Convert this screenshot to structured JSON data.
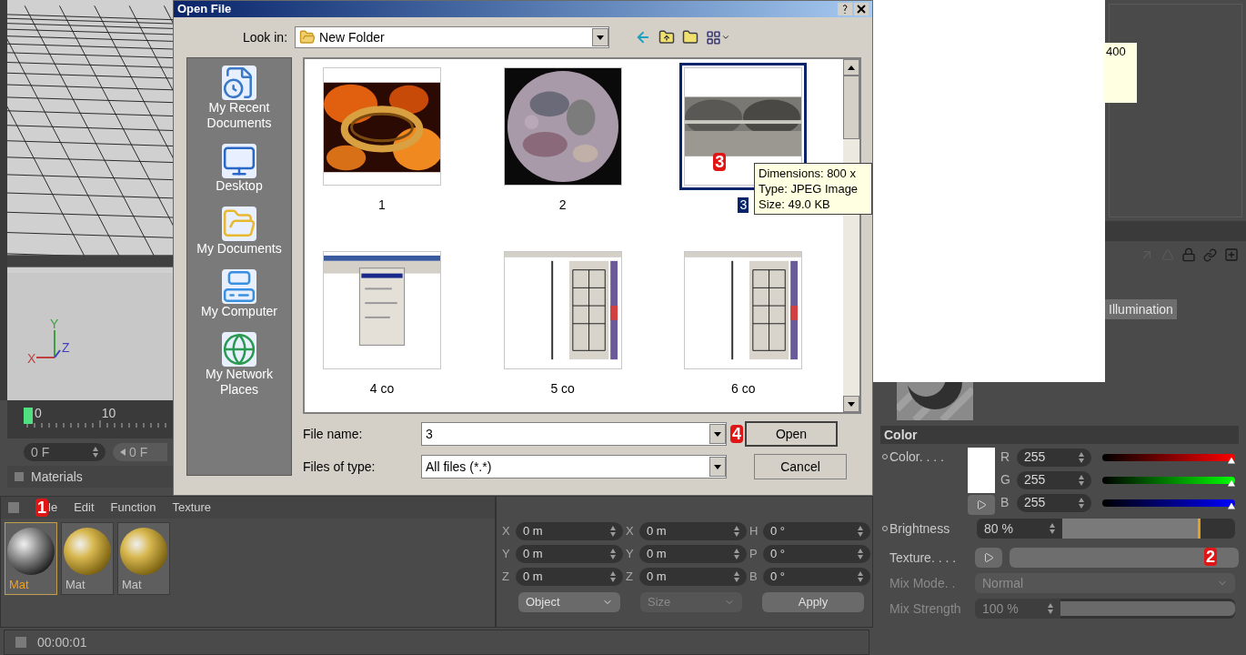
{
  "viewport": {
    "axes": [
      "X",
      "Y",
      "Z"
    ]
  },
  "timeline": {
    "ticks": [
      "0",
      "10"
    ],
    "current_frame": "0 F",
    "start_frame": "0 F"
  },
  "materials": {
    "title": "Materials",
    "marker": "1",
    "menu": [
      "le",
      "Edit",
      "Function",
      "Texture"
    ],
    "items": [
      {
        "label": "Mat",
        "kind": "grey",
        "selected": true
      },
      {
        "label": "Mat",
        "kind": "gold",
        "selected": false
      },
      {
        "label": "Mat",
        "kind": "gold",
        "selected": false
      }
    ]
  },
  "coordinates": {
    "rows": [
      {
        "axis": "X",
        "position": "0 m",
        "size_axis": "X",
        "size": "0 m",
        "rotation_axis": "H",
        "rotation": "0 °"
      },
      {
        "axis": "Y",
        "position": "0 m",
        "size_axis": "Y",
        "size": "0 m",
        "rotation_axis": "P",
        "rotation": "0 °"
      },
      {
        "axis": "Z",
        "position": "0 m",
        "size_axis": "Z",
        "size": "0 m",
        "rotation_axis": "B",
        "rotation": "0 °"
      }
    ],
    "mode": {
      "label": "Object",
      "disabled": false
    },
    "size_mode": {
      "label": "Size",
      "disabled": true
    },
    "apply": "Apply"
  },
  "status_bar": {
    "time": "00:00:01"
  },
  "dialog": {
    "title": "Open File",
    "look_in_label": "Look in:",
    "look_in": "New Folder",
    "places": [
      {
        "label": "My Recent Documents",
        "kind": "recent"
      },
      {
        "label": "Desktop",
        "kind": "desktop"
      },
      {
        "label": "My Documents",
        "kind": "documents"
      },
      {
        "label": "My Computer",
        "kind": "computer"
      },
      {
        "label": "My Network Places",
        "kind": "network"
      }
    ],
    "files": [
      {
        "name": "1",
        "kind": "fire",
        "selected": false
      },
      {
        "name": "2",
        "kind": "moon",
        "selected": false
      },
      {
        "name": "3",
        "kind": "panorama",
        "selected": true,
        "marker": "3"
      },
      {
        "name": "4 co",
        "kind": "menu_screenshot",
        "selected": false
      },
      {
        "name": "5 co",
        "kind": "editor_screenshot",
        "selected": false
      },
      {
        "name": "6 co",
        "kind": "editor_screenshot",
        "selected": false
      }
    ],
    "tooltip": [
      "Dimensions: 800 x",
      "Type: JPEG Image",
      "Size: 49.0 KB"
    ],
    "file_name_label": "File name:",
    "file_name": "3",
    "file_type_label": "Files of type:",
    "file_type": "All files (*.*)",
    "open_marker": "4",
    "buttons": [
      "Open",
      "Cancel"
    ]
  },
  "attributes": {
    "tooltip_fragment": "400",
    "tab": "Illumination",
    "section": "Color",
    "color_label": "Color. . . .",
    "channels": [
      {
        "name": "R",
        "value": "255",
        "level": 1,
        "color": "#ff0000"
      },
      {
        "name": "G",
        "value": "255",
        "level": 1,
        "color": "#00ff00"
      },
      {
        "name": "B",
        "value": "255",
        "level": 1,
        "color": "#0000ff"
      }
    ],
    "brightness": {
      "label": "Brightness",
      "value": "80 %",
      "level": 0.8
    },
    "texture": {
      "label": "Texture. . . .",
      "marker": "2"
    },
    "mix_mode": {
      "label": "Mix Mode. .",
      "value": "Normal",
      "disabled": true
    },
    "mix_strength": {
      "label": "Mix Strength",
      "value": "100 %",
      "level": 1,
      "disabled": true
    }
  }
}
